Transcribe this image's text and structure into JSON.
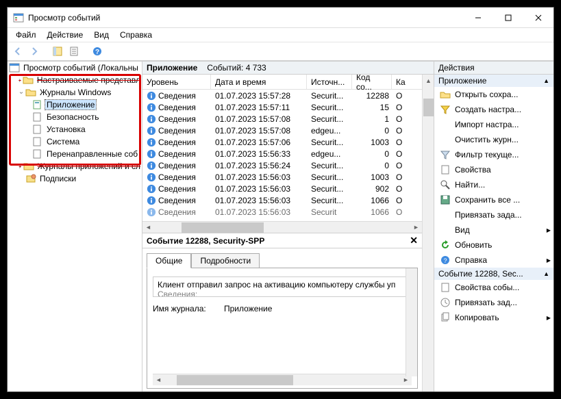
{
  "titlebar": {
    "title": "Просмотр событий"
  },
  "menubar": {
    "file": "Файл",
    "action": "Действие",
    "view": "Вид",
    "help": "Справка"
  },
  "tree": {
    "root": "Просмотр событий (Локальны",
    "custom_views": "Настраиваемые представл",
    "windows_logs": "Журналы Windows",
    "application": "Приложение",
    "security": "Безопасность",
    "setup": "Установка",
    "system": "Система",
    "forwarded": "Перенаправленные соб",
    "app_service_logs": "Журналы  приложений  и  сл",
    "subscriptions": "Подписки"
  },
  "mid_header": {
    "title": "Приложение",
    "count_label": "Событий: 4 733"
  },
  "columns": {
    "level": "Уровень",
    "datetime": "Дата и время",
    "source": "Источн...",
    "eventid": "Код со...",
    "cat": "Ка"
  },
  "rows": [
    {
      "level": "Сведения",
      "dt": "01.07.2023 15:57:28",
      "src": "Securit...",
      "id": "12288",
      "cat": "О"
    },
    {
      "level": "Сведения",
      "dt": "01.07.2023 15:57:11",
      "src": "Securit...",
      "id": "15",
      "cat": "О"
    },
    {
      "level": "Сведения",
      "dt": "01.07.2023 15:57:08",
      "src": "Securit...",
      "id": "1",
      "cat": "О"
    },
    {
      "level": "Сведения",
      "dt": "01.07.2023 15:57:08",
      "src": "edgeu...",
      "id": "0",
      "cat": "О"
    },
    {
      "level": "Сведения",
      "dt": "01.07.2023 15:57:06",
      "src": "Securit...",
      "id": "1003",
      "cat": "О"
    },
    {
      "level": "Сведения",
      "dt": "01.07.2023 15:56:33",
      "src": "edgeu...",
      "id": "0",
      "cat": "О"
    },
    {
      "level": "Сведения",
      "dt": "01.07.2023 15:56:24",
      "src": "Securit...",
      "id": "0",
      "cat": "О"
    },
    {
      "level": "Сведения",
      "dt": "01.07.2023 15:56:03",
      "src": "Securit...",
      "id": "1003",
      "cat": "О"
    },
    {
      "level": "Сведения",
      "dt": "01.07.2023 15:56:03",
      "src": "Securit...",
      "id": "902",
      "cat": "О"
    },
    {
      "level": "Сведения",
      "dt": "01.07.2023 15:56:03",
      "src": "Securit...",
      "id": "1066",
      "cat": "О"
    }
  ],
  "last_partial": {
    "level": "Сведения",
    "dt": "01.07.2023 15:56:03",
    "src": "Securit",
    "id": "1066",
    "cat": "О"
  },
  "details": {
    "title": "Событие 12288, Security-SPP",
    "tab_general": "Общие",
    "tab_details": "Подробности",
    "message": "Клиент отправил запрос на активацию компьютеру службы уп",
    "message2": "Сведения:",
    "logname_label": "Имя журнала:",
    "logname_value": "Приложение"
  },
  "actions": {
    "header": "Действия",
    "group1": "Приложение",
    "open_saved": "Открыть сохра...",
    "create_custom": "Создать настра...",
    "import_custom": "Импорт настра...",
    "clear_log": "Очистить журн...",
    "filter_log": "Фильтр текуще...",
    "properties": "Свойства",
    "find": "Найти...",
    "save_all": "Сохранить все ...",
    "attach_task": "Привязать зада...",
    "view": "Вид",
    "refresh": "Обновить",
    "help": "Справка",
    "group2": "Событие 12288, Sec...",
    "event_props": "Свойства собы...",
    "attach_task2": "Привязать зад...",
    "copy": "Копировать"
  }
}
